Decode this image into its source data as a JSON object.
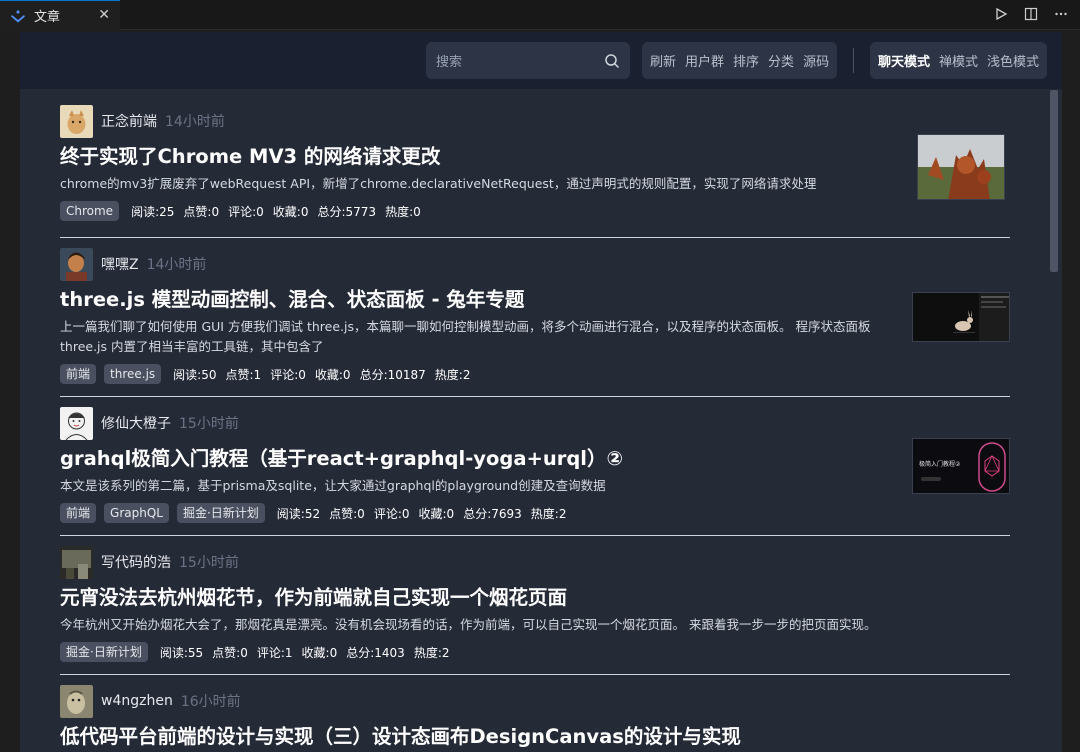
{
  "tab": {
    "label": "文章",
    "close": "✕"
  },
  "header": {
    "search_placeholder": "搜索",
    "nav": [
      "刷新",
      "用户群",
      "排序",
      "分类",
      "源码"
    ],
    "modes": [
      {
        "label": "聊天模式",
        "active": true
      },
      {
        "label": "禅模式",
        "active": false
      },
      {
        "label": "浅色模式",
        "active": false
      }
    ]
  },
  "articles": [
    {
      "author": "正念前端",
      "time": "14小时前",
      "title": "终于实现了Chrome MV3 的网络请求更改",
      "desc": "chrome的mv3扩展废弃了webRequest API，新增了chrome.declarativeNetRequest，通过声明式的规则配置，实现了网络请求处理",
      "tags": [
        "Chrome"
      ],
      "stats": [
        "阅读:25",
        "点赞:0",
        "评论:0",
        "收藏:0",
        "总分:5773",
        "热度:0"
      ]
    },
    {
      "author": "嘿嘿Z",
      "time": "14小时前",
      "title": "three.js 模型动画控制、混合、状态面板 - 兔年专题",
      "desc": "上一篇我们聊了如何使用 GUI 方便我们调试 three.js，本篇聊一聊如何控制模型动画，将多个动画进行混合，以及程序的状态面板。 程序状态面板 three.js 内置了相当丰富的工具链，其中包含了",
      "tags": [
        "前端",
        "three.js"
      ],
      "stats": [
        "阅读:50",
        "点赞:1",
        "评论:0",
        "收藏:0",
        "总分:10187",
        "热度:2"
      ]
    },
    {
      "author": "修仙大橙子",
      "time": "15小时前",
      "title": "grahql极简入门教程（基于react+graphql-yoga+urql）②",
      "desc": "本文是该系列的第二篇，基于prisma及sqlite，让大家通过graphql的playground创建及查询数据",
      "tags": [
        "前端",
        "GraphQL",
        "掘金·日新计划"
      ],
      "stats": [
        "阅读:52",
        "点赞:0",
        "评论:0",
        "收藏:0",
        "总分:7693",
        "热度:2"
      ],
      "thumb_text": "极简入门教程②"
    },
    {
      "author": "写代码的浩",
      "time": "15小时前",
      "title": "元宵没法去杭州烟花节，作为前端就自己实现一个烟花页面",
      "desc": "今年杭州又开始办烟花大会了，那烟花真是漂亮。没有机会现场看的话，作为前端，可以自己实现一个烟花页面。 来跟着我一步一步的把页面实现。",
      "tags": [
        "掘金·日新计划"
      ],
      "stats": [
        "阅读:55",
        "点赞:0",
        "评论:1",
        "收藏:0",
        "总分:1403",
        "热度:2"
      ]
    },
    {
      "author": "w4ngzhen",
      "time": "16小时前",
      "title": "低代码平台前端的设计与实现（三）设计态画布DesignCanvas的设计与实现"
    }
  ]
}
